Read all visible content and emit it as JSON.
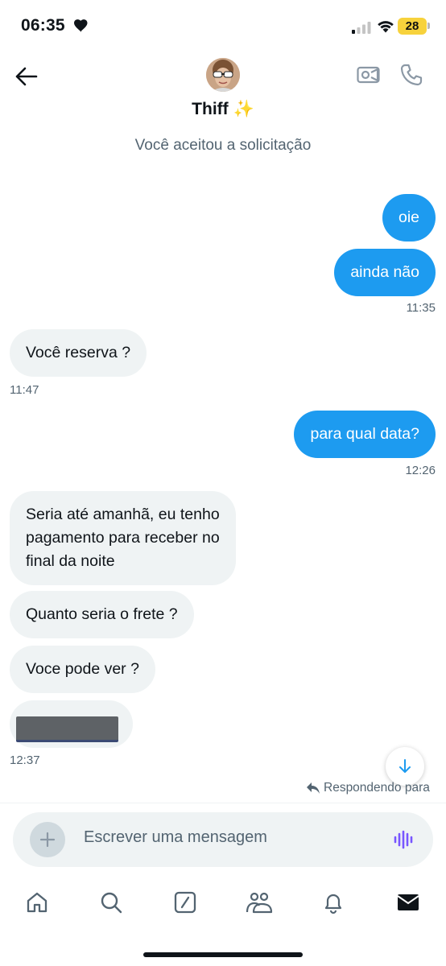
{
  "status_bar": {
    "time": "06:35",
    "battery": "28"
  },
  "header": {
    "name": "Thiff",
    "sparkle": "✨"
  },
  "system_message": "Você aceitou a solicitação",
  "messages": [
    {
      "side": "sent",
      "text": "oie"
    },
    {
      "side": "sent",
      "text": "ainda não",
      "time": "11:35"
    },
    {
      "side": "received",
      "text": "Você reserva ?",
      "time": "11:47"
    },
    {
      "side": "sent",
      "text": "para qual data?",
      "time": "12:26"
    },
    {
      "side": "received",
      "lines": [
        "Seria até amanhã, eu tenho",
        "pagamento para receber no",
        "final da noite"
      ]
    },
    {
      "side": "received",
      "text": "Quanto seria o frete ?"
    },
    {
      "side": "received",
      "text": "Voce pode ver ?"
    },
    {
      "side": "received",
      "attachment": "image",
      "time": "12:37"
    }
  ],
  "replying_label": "Respondendo para",
  "composer": {
    "placeholder": "Escrever uma mensagem"
  },
  "tabs": [
    "home-icon",
    "search-icon",
    "grok-icon",
    "communities-icon",
    "notifications-icon",
    "messages-icon"
  ],
  "colors": {
    "accent": "#1d9bf0",
    "received_bubble": "#eff3f4",
    "secondary_text": "#536471",
    "voice_icon": "#7856ff"
  }
}
